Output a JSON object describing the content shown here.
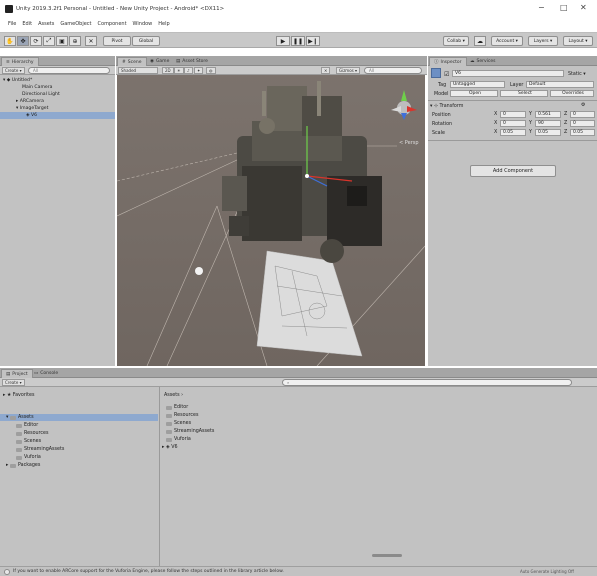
{
  "window": {
    "title": "Unity 2019.3.2f1 Personal - Untitled - New Unity Project - Android* <DX11>",
    "minimize": "−",
    "maximize": "□",
    "close": "✕"
  },
  "menu": [
    "File",
    "Edit",
    "Assets",
    "GameObject",
    "Component",
    "Window",
    "Help"
  ],
  "toolbar": {
    "pivot": "Pivot",
    "global": "Global",
    "collab": "Collab ▾",
    "account": "Account ▾",
    "layers": "Layers ▾",
    "layout": "Layout ▾"
  },
  "hierarchy": {
    "tab": "Hierarchy",
    "create": "Create ▾",
    "search_placeholder": "All",
    "items": [
      "Untitled*",
      "Main Camera",
      "Directional Light",
      "ARCamera",
      "ImageTarget",
      "V6"
    ]
  },
  "scene_view": {
    "tabs": [
      "Scene",
      "Game",
      "Asset Store"
    ],
    "shading": "Shaded",
    "mode": "2D",
    "gizmos": "Gizmos ▾",
    "search_placeholder": "All",
    "persp_label": "< Persp"
  },
  "inspector": {
    "tabs": [
      "Inspector",
      "Services"
    ],
    "object_name": "V6",
    "static_label": "Static ▾",
    "tag_label": "Tag",
    "tag_value": "Untagged",
    "layer_label": "Layer",
    "layer_value": "Default",
    "model_label": "Model",
    "model_buttons": [
      "Open",
      "Select",
      "Overrides"
    ],
    "transform_title": "Transform",
    "rows": [
      {
        "label": "Position",
        "x": "0",
        "y": "0.561",
        "z": "0"
      },
      {
        "label": "Rotation",
        "x": "0",
        "y": "90",
        "z": "0"
      },
      {
        "label": "Scale",
        "x": "0.05",
        "y": "0.05",
        "z": "0.05"
      }
    ],
    "add_component": "Add Component"
  },
  "project": {
    "tabs": [
      "Project",
      "Console"
    ],
    "create": "Create ▾",
    "favorites": "Favorites",
    "left_items": [
      "Assets",
      "Editor",
      "Resources",
      "Scenes",
      "StreamingAssets",
      "Vuforia",
      "Packages"
    ],
    "breadcrumb": "Assets ›",
    "right_items": [
      "Editor",
      "Resources",
      "Scenes",
      "StreamingAssets",
      "Vuforia",
      "V6"
    ]
  },
  "status": {
    "message": "If you want to enable ARCore support for the Vuforia Engine, please follow the steps outlined in the library article below.",
    "right": "Auto Generate Lighting Off"
  }
}
